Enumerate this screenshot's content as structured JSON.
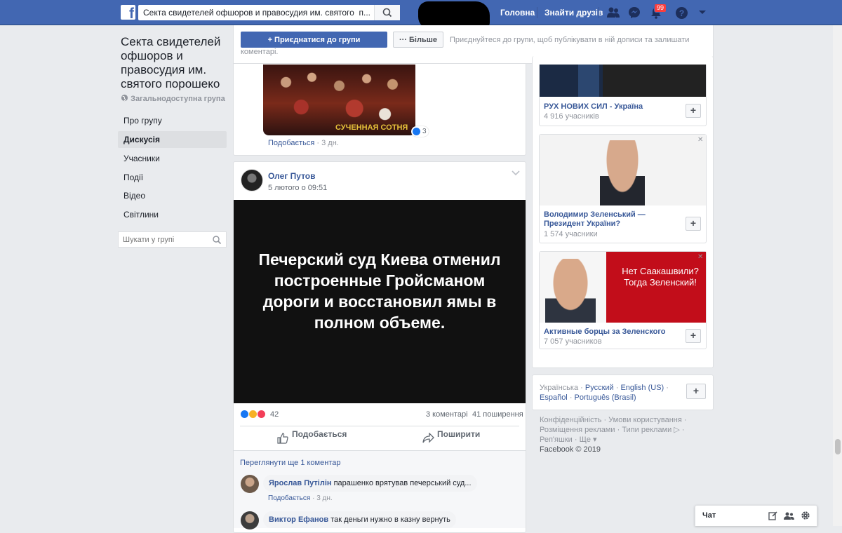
{
  "topbar": {
    "search_value": "Секта свидетелей офшоров и правосудия им. святого  п...",
    "nav_home": "Головна",
    "nav_find_friends": "Знайти друзів",
    "notifications_count": "99",
    "colors": {
      "bar": "#4267b2",
      "badge": "#fa3e3e"
    }
  },
  "group": {
    "title": "Секта свидетелей офшоров и правосудия им. святого порошеко",
    "privacy": "Загальнодоступна група",
    "nav": [
      {
        "label": "Про групу"
      },
      {
        "label": "Дискусія"
      },
      {
        "label": "Учасники"
      },
      {
        "label": "Події"
      },
      {
        "label": "Відео"
      },
      {
        "label": "Світлини"
      }
    ],
    "search_placeholder": "Шукати у групі"
  },
  "join_bar": {
    "join_label": "Приєднатися до групи",
    "more_label": "Більше",
    "hint": "Приєднуйтеся до групи, щоб публікувати в ній дописи та залишати коментарі."
  },
  "post1": {
    "image_caption": "СУЧЕННАЯ СОТНЯ",
    "reaction_count": "3",
    "like_link": "Подобається",
    "time": "3 дн."
  },
  "post2": {
    "author": "Олег Путов",
    "date": "5 лютого о 09:51",
    "image_text": "Печерский суд Киева отменил построенные Гройсманом дороги и восстановил ямы в полном объеме.",
    "reactions_total": "42",
    "comments_count": "3 коментарі",
    "shares_count": "41 поширення",
    "like_button": "Подобається",
    "share_button": "Поширити",
    "view_more_comments": "Переглянути ще 1 коментар",
    "comments": [
      {
        "author": "Ярослав Путілін",
        "text": "парашенко врятував печерський суд...",
        "like": "Подобається",
        "time": "3 дн."
      },
      {
        "author": "Виктор Ефанов",
        "text": "так деньги нужно в казну вернуть"
      }
    ]
  },
  "suggestions": [
    {
      "name": "РУХ НОВИХ СИЛ - Україна",
      "members": "4 916 учасників"
    },
    {
      "name": "Володимир Зеленський — Президент України?",
      "members": "1 574 учасники"
    },
    {
      "name": "Активные борцы за Зеленского",
      "members": "7 057 учасников",
      "banner_text": "Нет Саакашвили? Тогда Зеленский!"
    }
  ],
  "languages": {
    "current": "Українська",
    "options": [
      "Русский",
      "English (US)",
      "Español",
      "Português (Brasil)"
    ]
  },
  "footer": {
    "links": [
      "Конфіденційність",
      "Умови користування",
      "Розміщення реклами",
      "Типи реклами",
      "Реп'яшки",
      "Ще"
    ],
    "copyright": "Facebook © 2019"
  },
  "chat": {
    "label": "Чат"
  }
}
